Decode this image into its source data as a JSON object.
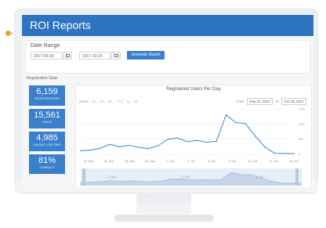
{
  "header": {
    "title": "ROI Reports"
  },
  "date_range": {
    "label": "Date Range",
    "start": "2017-09-23",
    "end": "2017-10-23",
    "generate_label": "Generate Report"
  },
  "section_label": "Registration Stats",
  "stats": [
    {
      "value": "6,159",
      "label": "REGISTRATIONS"
    },
    {
      "value": "15,561",
      "label": "VISITS"
    },
    {
      "value": "4,985",
      "label": "UNIQUE VISITORS"
    },
    {
      "value": "81%",
      "label": "TURNOUT"
    }
  ],
  "chart": {
    "title": "Registered Users Per Day",
    "zoom_label": "Zoom",
    "zoom_options": [
      "1m",
      "3m",
      "6m",
      "YTD",
      "1y",
      "All"
    ],
    "from_label": "From",
    "from_value": "Sep 22, 2017",
    "to_label": "To",
    "to_value": "Oct 15, 2017",
    "navigator_labels": [
      "24 Sep",
      "1. Oct",
      "8. Oct"
    ]
  },
  "chart_data": {
    "type": "line",
    "title": "Registered Users Per Day",
    "x_ticks": [
      "24. Sep",
      "26. Sep",
      "28. Sep",
      "30. Sep",
      "2. Oct",
      "4. Oct",
      "6. Oct",
      "8. Oct",
      "10. Oct",
      "12. Oct",
      "14. Oct"
    ],
    "y_ticks": [
      0,
      500,
      1000,
      1500
    ],
    "ylim": [
      0,
      1500
    ],
    "x": [
      "22 Sep",
      "23 Sep",
      "24 Sep",
      "25 Sep",
      "26 Sep",
      "27 Sep",
      "28 Sep",
      "29 Sep",
      "30 Sep",
      "1 Oct",
      "2 Oct",
      "3 Oct",
      "4 Oct",
      "5 Oct",
      "6 Oct",
      "7 Oct",
      "8 Oct",
      "9 Oct",
      "10 Oct",
      "11 Oct",
      "12 Oct",
      "13 Oct",
      "14 Oct"
    ],
    "values": [
      120,
      140,
      200,
      330,
      250,
      300,
      230,
      190,
      290,
      500,
      540,
      420,
      460,
      400,
      430,
      1300,
      1050,
      1020,
      610,
      240,
      40,
      30,
      20
    ],
    "color": "#4a8fd6"
  }
}
